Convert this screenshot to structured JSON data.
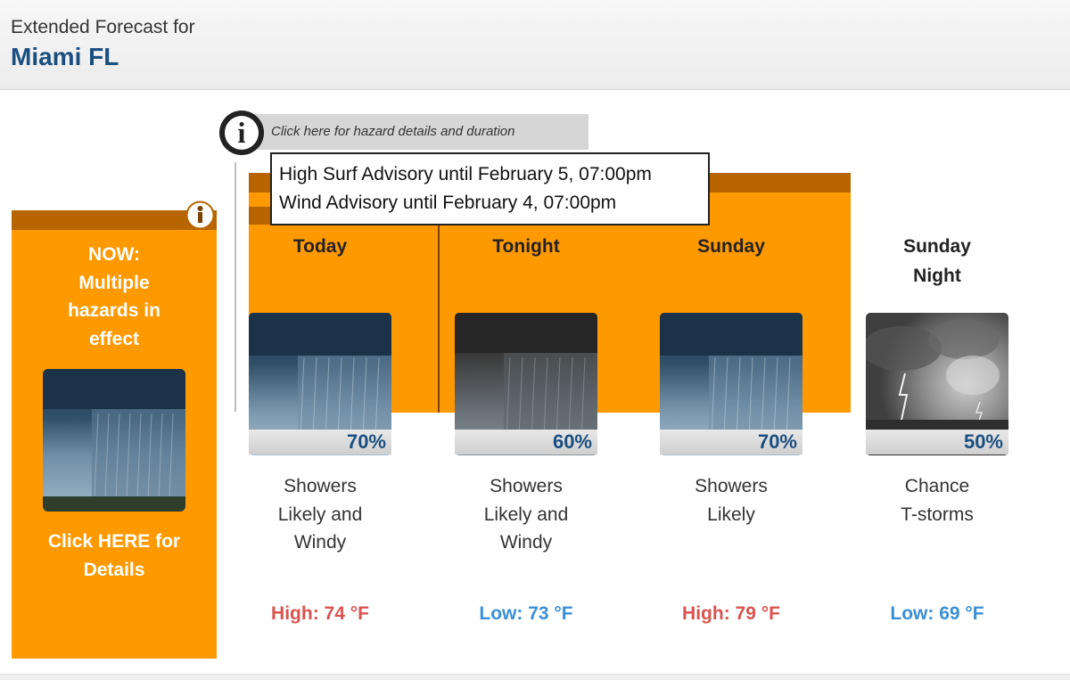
{
  "header": {
    "subtitle": "Extended Forecast for",
    "city": "Miami FL"
  },
  "hazard_panel": {
    "title_lines": [
      "NOW:",
      "Multiple",
      "hazards in",
      "effect"
    ],
    "link_lines": [
      "Click HERE for",
      "Details"
    ],
    "icon": "info-icon"
  },
  "hazard_bar": {
    "prompt": "Click here for hazard details and duration",
    "icon": "info-icon"
  },
  "tooltip": {
    "lines": [
      "High Surf Advisory until February 5, 07:00pm",
      "Wind Advisory until February 4, 07:00pm"
    ]
  },
  "periods": [
    {
      "name": "Today",
      "precip": "70%",
      "desc": [
        "Showers",
        "Likely and",
        "Windy"
      ],
      "temp": "High: 74 °F",
      "kind": "high",
      "image": "showers"
    },
    {
      "name": "Tonight",
      "precip": "60%",
      "desc": [
        "Showers",
        "Likely and",
        "Windy"
      ],
      "temp": "Low: 73 °F",
      "kind": "low",
      "image": "showers-night"
    },
    {
      "name": "Sunday",
      "precip": "70%",
      "desc": [
        "Showers",
        "Likely"
      ],
      "temp": "High: 79 °F",
      "kind": "high",
      "image": "showers"
    },
    {
      "name_lines": [
        "Sunday",
        "Night"
      ],
      "precip": "50%",
      "desc": [
        "Chance",
        "T-storms"
      ],
      "temp": "Low: 69 °F",
      "kind": "low",
      "image": "tstorms-night"
    }
  ],
  "colors": {
    "hazard_orange": "#ff9900",
    "hazard_dark": "#b86500",
    "city_blue": "#1a4f80",
    "high_red": "#d9534f",
    "low_blue": "#3a8fd6"
  }
}
